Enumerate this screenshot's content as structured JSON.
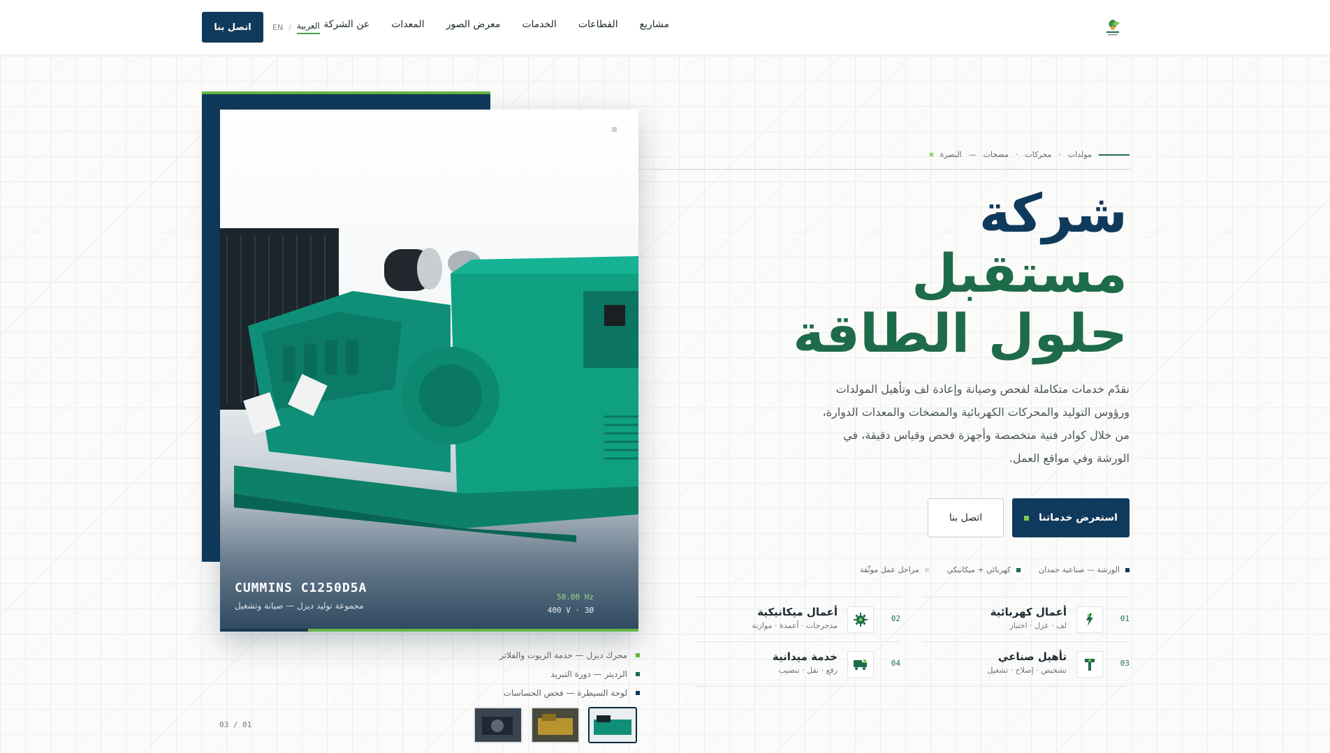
{
  "header": {
    "nav": [
      "مشاريع",
      "القطاعات",
      "الخدمات",
      "معرض الصور",
      "المعدات",
      "عن الشركة"
    ],
    "lang_ar": "العربية",
    "lang_en": "EN",
    "lang_sep": "/",
    "cta": "اتصل بنا",
    "logo_icon": "leaf-logo-icon"
  },
  "hero": {
    "eyebrow": [
      "مولدات",
      "·",
      "محركات",
      "·",
      "مضخات",
      "—",
      "البصرة"
    ],
    "headline_1": "شركة",
    "headline_2": "مستقبل",
    "headline_3": "حلول الطاقة",
    "lead": "نقدّم خدمات متكاملة لفحص وصيانة وإعادة لف وتأهيل المولدات ورؤوس التوليد والمحركات الكهربائية والمضخات والمعدات الدوارة، من خلال كوادر فنية متخصصة وأجهزة فحص وقياس دقيقة، في الورشة وفي مواقع العمل.",
    "primary_button": "استعرض خدماتنا",
    "secondary_button": "اتصل بنا",
    "meta": [
      "الورشة — صناعية حمدان",
      "كهربائي + ميكانيكي",
      "مراحل عمل موثّقة"
    ]
  },
  "services": [
    {
      "num": "01",
      "title": "أعمال كهربائية",
      "sub": "لف · عزل · اختبار",
      "icon": "lightning-icon"
    },
    {
      "num": "02",
      "title": "أعمال ميكانيكية",
      "sub": "مدحرجات · أعمدة · موازنة",
      "icon": "gear-icon"
    },
    {
      "num": "03",
      "title": "تأهيل صناعي",
      "sub": "تشخيص · إصلاح · تشغيل",
      "icon": "wrench-icon"
    },
    {
      "num": "04",
      "title": "خدمة ميدانية",
      "sub": "رفع · نقل · تنصيب",
      "icon": "truck-icon"
    }
  ],
  "showcase": {
    "model": "CUMMINS C1250D5A",
    "model_sub": "مجموعة توليد ديزل — صيانة وتشغيل",
    "freq": "50.00 Hz",
    "volt": "400 V · 3Ø",
    "progress": 0.79,
    "parts": [
      "محرك ديزل — خدمة الزيوت والفلاتر",
      "الرديتر — دورة التبريد",
      "لوحة السيطرة — فحص الحساسات"
    ],
    "counter": "03 / 01"
  },
  "colors": {
    "navy": "#103a5c",
    "green": "#1e6b4a",
    "accent": "#63b545",
    "generator": "#0f8f78"
  }
}
